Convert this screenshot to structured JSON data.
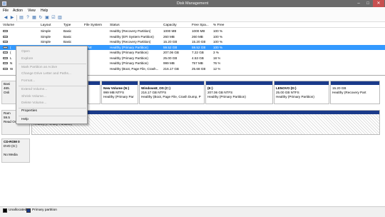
{
  "window": {
    "title": "Disk Management",
    "controls": [
      "–",
      "□",
      "✕"
    ]
  },
  "menu": [
    "File",
    "Action",
    "View",
    "Help"
  ],
  "toolbar": {
    "icons": [
      "back-icon",
      "forward-icon",
      "list-icon",
      "help-icon",
      "properties-icon",
      "refresh-icon",
      "open-icon",
      "check-icon",
      "view-icon"
    ]
  },
  "volume_list": {
    "columns": [
      "Volume",
      "Layout",
      "Type",
      "File System",
      "Status",
      "Capacity",
      "Free Spa...",
      "% Free"
    ],
    "rows": [
      {
        "volume": "",
        "layout": "Simple",
        "type": "Basic",
        "fs": "",
        "status": "Healthy (Recovery Partition)",
        "capacity": "1000 MB",
        "free": "1000 MB",
        "pct": "100 %"
      },
      {
        "volume": "",
        "layout": "Simple",
        "type": "Basic",
        "fs": "",
        "status": "Healthy (EFI System Partition)",
        "capacity": "260 MB",
        "free": "260 MB",
        "pct": "100 %"
      },
      {
        "volume": "",
        "layout": "Simple",
        "type": "Basic",
        "fs": "",
        "status": "Healthy (Recovery Partition)",
        "capacity": "15.20 GB",
        "free": "15.20 GB",
        "pct": "100 %"
      },
      {
        "volume": "(",
        "layout": "",
        "type": "",
        "fs": "RAW",
        "status": "Healthy (Primary Partition)",
        "capacity": "59.52 GB",
        "free": "59.52 GB",
        "pct": "100 %"
      },
      {
        "volume": "(",
        "layout": "",
        "type": "",
        "fs": "",
        "status": "Healthy (Primary Partition)",
        "capacity": "207.06 GB",
        "free": "7.22 GB",
        "pct": "3 %"
      },
      {
        "volume": "L",
        "layout": "",
        "type": "",
        "fs": "",
        "status": "Healthy (Primary Partition)",
        "capacity": "25.00 GB",
        "free": "4.53 GB",
        "pct": "18 %"
      },
      {
        "volume": "N",
        "layout": "",
        "type": "",
        "fs": "",
        "status": "Healthy (Primary Partition)",
        "capacity": "999 MB",
        "free": "757 MB",
        "pct": "76 %"
      },
      {
        "volume": "W",
        "layout": "",
        "type": "",
        "fs": "",
        "status": "Healthy (Boot, Page File, Crash...",
        "capacity": "216.17 GB",
        "free": "25.68 GB",
        "pct": "12 %"
      }
    ]
  },
  "disk0": {
    "label_lines": [
      "Basi",
      "465.",
      "Onli"
    ],
    "partitions": [
      {
        "title": "",
        "line1": "",
        "line2": ""
      },
      {
        "title": "New Volume  (N:)",
        "line1": "999 MB NTFS",
        "line2": "Healthy (Primary Par"
      },
      {
        "title": "Windows8_OS  (C:)",
        "line1": "216.17 GB NTFS",
        "line2": "Healthy (Boot, Page File, Crash Dump, P"
      },
      {
        "title": "(E:)",
        "line1": "207.06 GB NTFS",
        "line2": "Healthy (Primary Partition)"
      },
      {
        "title": "LENOVO  (D:)",
        "line1": "25.00 GB NTFS",
        "line2": "Healthy (Primary Partition)"
      },
      {
        "title": "",
        "line1": "15.20 GB",
        "line2": "Healthy (Recovery Part"
      }
    ]
  },
  "disk1": {
    "label_lines": [
      "Ram",
      "59.5",
      "Read Only"
    ],
    "partition": {
      "line1": "Healthy (Primary Partition)"
    }
  },
  "cdrom": {
    "label_lines": [
      "CD-ROM 0",
      "DVD (G:)",
      "",
      "No Media"
    ]
  },
  "context_menu": {
    "items": [
      {
        "label": "Open",
        "enabled": false
      },
      {
        "label": "Explore",
        "enabled": false
      },
      {
        "label": "Mark Partition as Active",
        "enabled": false
      },
      {
        "label": "Change Drive Letter and Paths...",
        "enabled": false
      },
      {
        "label": "Format...",
        "enabled": false
      },
      {
        "label": "Extend Volume...",
        "enabled": false
      },
      {
        "label": "Shrink Volume...",
        "enabled": false
      },
      {
        "label": "Delete Volume...",
        "enabled": false
      },
      {
        "label": "Properties",
        "enabled": true
      },
      {
        "label": "Help",
        "enabled": true
      }
    ]
  },
  "legend": [
    {
      "label": "Unallocated",
      "color": "#000000"
    },
    {
      "label": "Primary partition",
      "color": "#1a3a8a"
    }
  ]
}
